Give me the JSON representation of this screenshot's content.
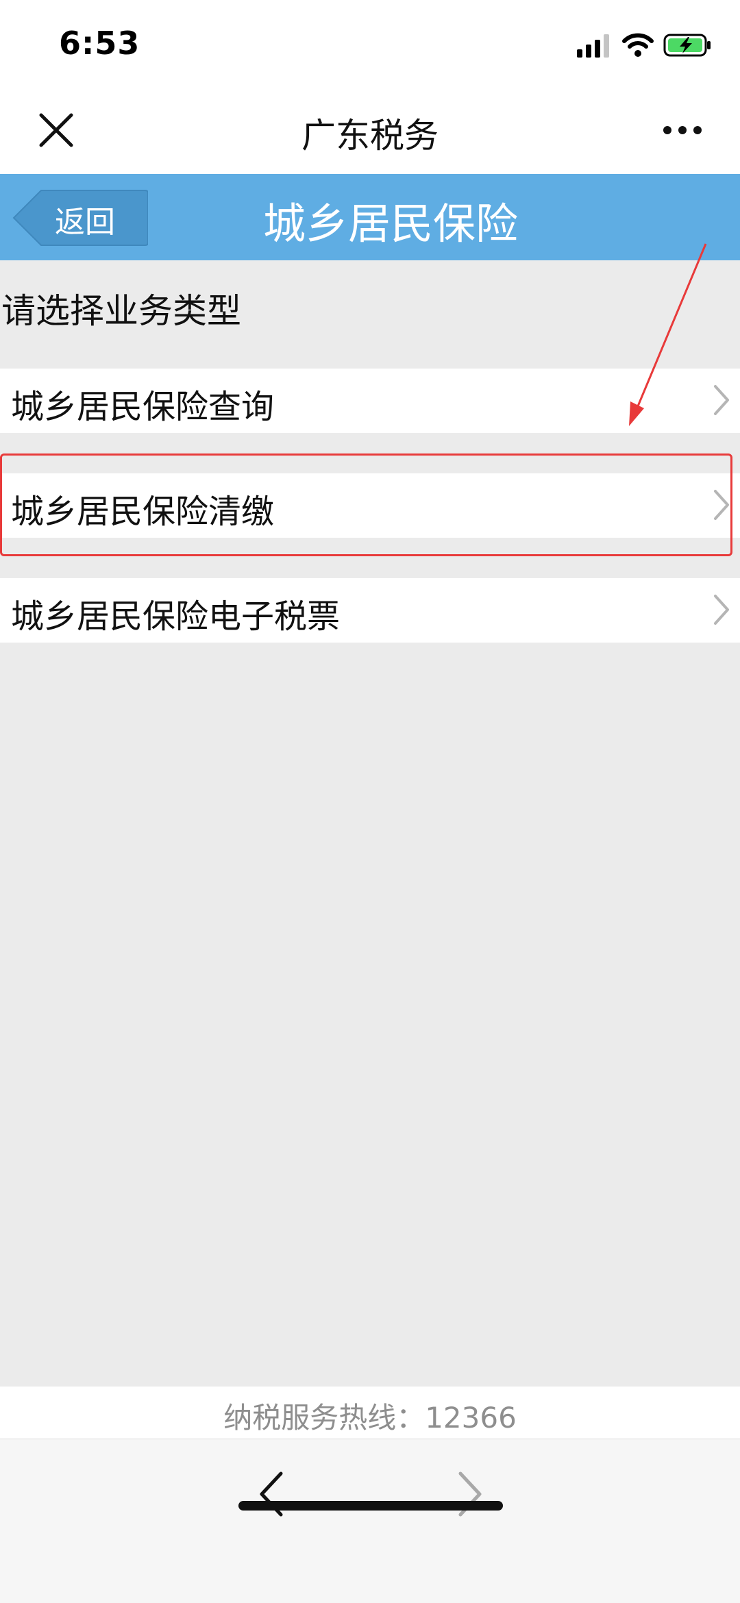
{
  "status_bar": {
    "time": "6:53",
    "icons": [
      "cellular-signal-icon",
      "wifi-icon",
      "battery-charging-icon"
    ],
    "battery_color": "#4cd964"
  },
  "nav_bar": {
    "title": "广东税务",
    "close_icon": "close-icon",
    "more_icon": "more-icon"
  },
  "header": {
    "back_label": "返回",
    "title": "城乡居民保险",
    "background_color": "#5fade3"
  },
  "content": {
    "prompt": "请选择业务类型",
    "items": [
      {
        "label": "城乡居民保险查询"
      },
      {
        "label": "城乡居民保险清缴"
      },
      {
        "label": "城乡居民保险电子税票"
      }
    ],
    "annotation_color": "#e83a3a"
  },
  "footer": {
    "hotline": "纳税服务热线：12366"
  },
  "toolbar": {
    "back_icon": "chevron-left-icon",
    "forward_icon": "chevron-right-icon"
  }
}
